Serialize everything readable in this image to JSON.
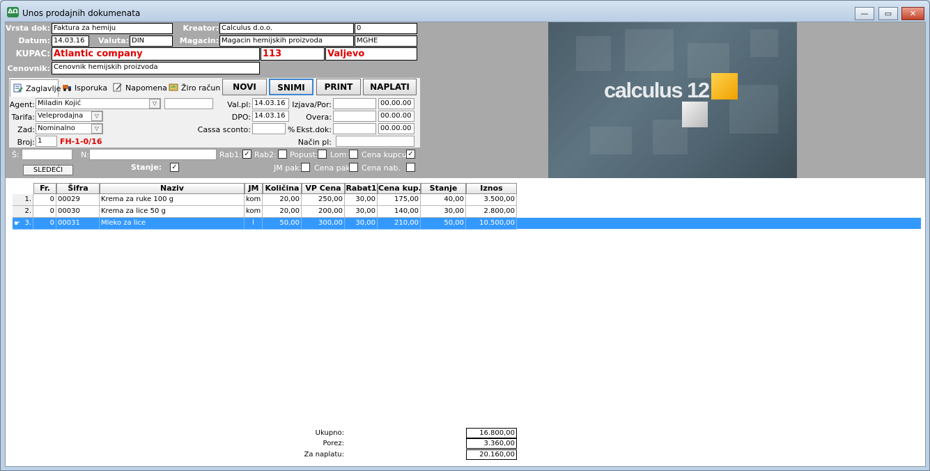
{
  "window": {
    "title": "Unos prodajnih dokumenata",
    "min_btn": "—",
    "max_btn": "▭",
    "close_btn": "✕",
    "app_icon_text": "ΔΩ"
  },
  "header": {
    "vrsta_label": "Vrsta dok:",
    "vrsta_value": "Faktura za hemiju",
    "kreator_label": "Kreator:",
    "kreator_value": "Calculus d.o.o.",
    "kreator_id": "0",
    "datum_label": "Datum:",
    "datum_value": "14.03.16",
    "valuta_label": "Valuta:",
    "valuta_value": "DIN",
    "magacin_label": "Magacin:",
    "magacin_value": "Magacin hemijskih proizvoda",
    "magacin_code": "MGHE",
    "kupac_label": "KUPAC:",
    "kupac_value": "Atlantic company",
    "kupac_code": "113",
    "kupac_city": "Valjevo",
    "cenovnik_label": "Cenovnik:",
    "cenovnik_value": "Cenovnik hemijskih proizvoda"
  },
  "tabs": [
    {
      "label": "Zaglavlje"
    },
    {
      "label": "Isporuka"
    },
    {
      "label": "Napomena"
    },
    {
      "label": "Žiro račun"
    }
  ],
  "actions": {
    "novi": "NOVI",
    "snimi": "SNIMI",
    "print": "PRINT",
    "naplati": "NAPLATI"
  },
  "panel": {
    "agent_label": "Agent:",
    "agent_value": "Miladin Kojić",
    "tarifa_label": "Tarifa:",
    "tarifa_value": "Veleprodajna",
    "zad_label": "Zad:",
    "zad_value": "Nominalno",
    "broj_label": "Broj:",
    "broj_value": "1",
    "broj_doc": "FH-1-0/16",
    "valpl_label": "Val.pl:",
    "valpl_value": "14.03.16",
    "dpo_label": "DPO:",
    "dpo_value": "14.03.16",
    "cassa_label": "Cassa sconto:",
    "cassa_unit": "%",
    "izjava_label": "Izjava/Por:",
    "izjava_date": "00.00.00",
    "overa_label": "Overa:",
    "overa_date": "00.00.00",
    "ekst_label": "Ekst.dok:",
    "ekst_date": "00.00.00",
    "nacin_label": "Način pl:"
  },
  "filters": {
    "s_label": "Š:",
    "n_label": "N:",
    "sledeci": "SLEDEĆI",
    "stanje_label": "Stanje:",
    "rab1": "Rab1:",
    "rab2": "Rab2:",
    "popust": "Popust:",
    "lom": "Lom:",
    "cena_kupcu": "Cena kupcu:",
    "jm_pak": "JM pak:",
    "cena_pak": "Cena pak:",
    "cena_nab": "Cena nab.",
    "checked_mark": "✓"
  },
  "banner": {
    "text": "calculus 12"
  },
  "table": {
    "headers": [
      "Fr.",
      "Šifra",
      "Naziv",
      "JM",
      "Količina",
      "VP Cena",
      "Rabat1",
      "Cena kup.",
      "Stanje",
      "Iznos"
    ],
    "rows": [
      {
        "rn": "1.",
        "fr": "0",
        "sifra": "00029",
        "naziv": "Krema za ruke 100 g",
        "jm": "kom",
        "kol": "20,00",
        "vp": "250,00",
        "rab": "30,00",
        "ck": "175,00",
        "stanje": "40,00",
        "iznos": "3.500,00"
      },
      {
        "rn": "2.",
        "fr": "0",
        "sifra": "00030",
        "naziv": "Krema za lice 50 g",
        "jm": "kom",
        "kol": "20,00",
        "vp": "200,00",
        "rab": "30,00",
        "ck": "140,00",
        "stanje": "30,00",
        "iznos": "2.800,00"
      },
      {
        "rn": "3.",
        "fr": "0",
        "sifra": "00031",
        "naziv": "Mleko za lice",
        "jm": "l",
        "kol": "50,00",
        "vp": "300,00",
        "rab": "30,00",
        "ck": "210,00",
        "stanje": "50,00",
        "iznos": "10.500,00"
      }
    ]
  },
  "totals": {
    "ukupno_label": "Ukupno:",
    "ukupno_value": "16.800,00",
    "porez_label": "Porez:",
    "porez_value": "3.360,00",
    "za_naplatu_label": "Za naplatu:",
    "za_naplatu_value": "20.160,00"
  }
}
